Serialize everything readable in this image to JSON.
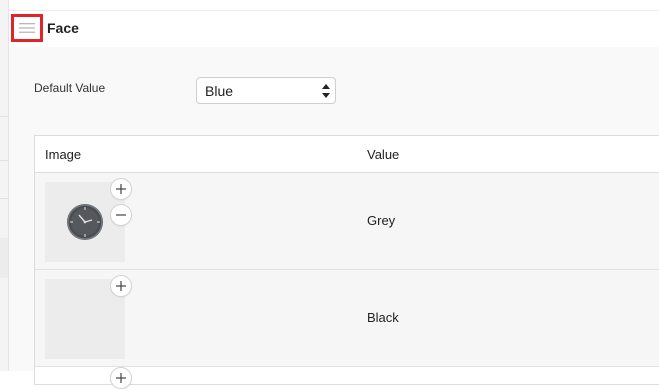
{
  "panel": {
    "title": "Face",
    "menu_icon": "hamburger-icon"
  },
  "field": {
    "label": "Default Value",
    "selected": "Blue"
  },
  "table": {
    "columns": [
      "Image",
      "Value"
    ],
    "rows": [
      {
        "value": "Grey",
        "has_image": true
      },
      {
        "value": "Black",
        "has_image": false
      }
    ]
  },
  "colors": {
    "highlight": "#e0242a",
    "row_bg": "#f6f6f6",
    "thumb_bg": "#ececec"
  }
}
